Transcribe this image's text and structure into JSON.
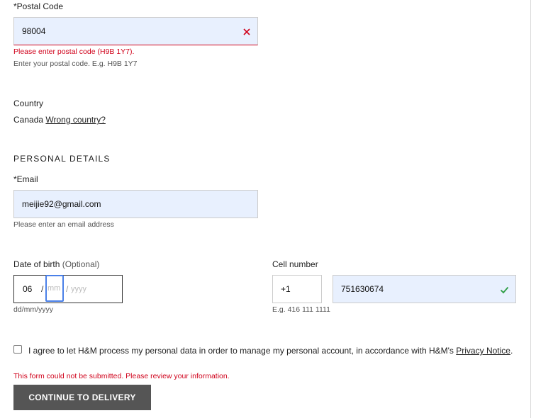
{
  "postal": {
    "label": "*Postal Code",
    "value": "98004",
    "error": "Please enter postal code (H9B 1Y7).",
    "hint": "Enter your postal code. E.g. H9B 1Y7",
    "clear_icon": "close-icon",
    "error_color": "#d0021b"
  },
  "country": {
    "label": "Country",
    "value": "Canada",
    "link": "Wrong country?"
  },
  "personal": {
    "heading": "PERSONAL DETAILS",
    "email_label": "*Email",
    "email_value": "meijie92@gmail.com",
    "email_hint": "Please enter an email address"
  },
  "dob": {
    "label": "Date of birth",
    "optional": "(Optional)",
    "day": "06",
    "sep1": "/",
    "month_placeholder": "mm",
    "sep2": "/",
    "year_placeholder": "yyyy",
    "hint": "dd/mm/yyyy"
  },
  "cell": {
    "label": "Cell number",
    "prefix": "+1",
    "value": "751630674",
    "hint": "E.g. 416 111 1111",
    "valid_icon": "checkmark-icon",
    "valid_color": "#2e9e44"
  },
  "consent": {
    "text": "I agree to let H&M process my personal data in order to manage my personal account, in accordance with H&M's",
    "link": "Privacy Notice",
    "end": "."
  },
  "form": {
    "error": "This form could not be submitted. Please review your information.",
    "submit_label": "CONTINUE TO DELIVERY"
  }
}
